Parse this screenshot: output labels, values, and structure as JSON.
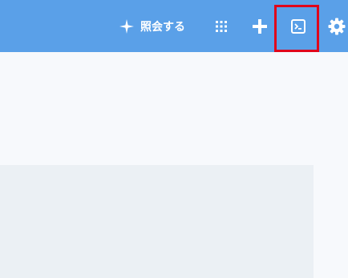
{
  "header": {
    "ask_button_label": "照会する",
    "icons": {
      "ask": "sparkle-icon",
      "apps": "apps-grid-icon",
      "add": "plus-icon",
      "console": "terminal-icon",
      "settings": "gear-icon"
    }
  },
  "colors": {
    "header_background": "#5aa0e8",
    "page_background": "#f7f9fc",
    "panel_background": "#ebf0f4",
    "highlight": "#e0061b"
  }
}
